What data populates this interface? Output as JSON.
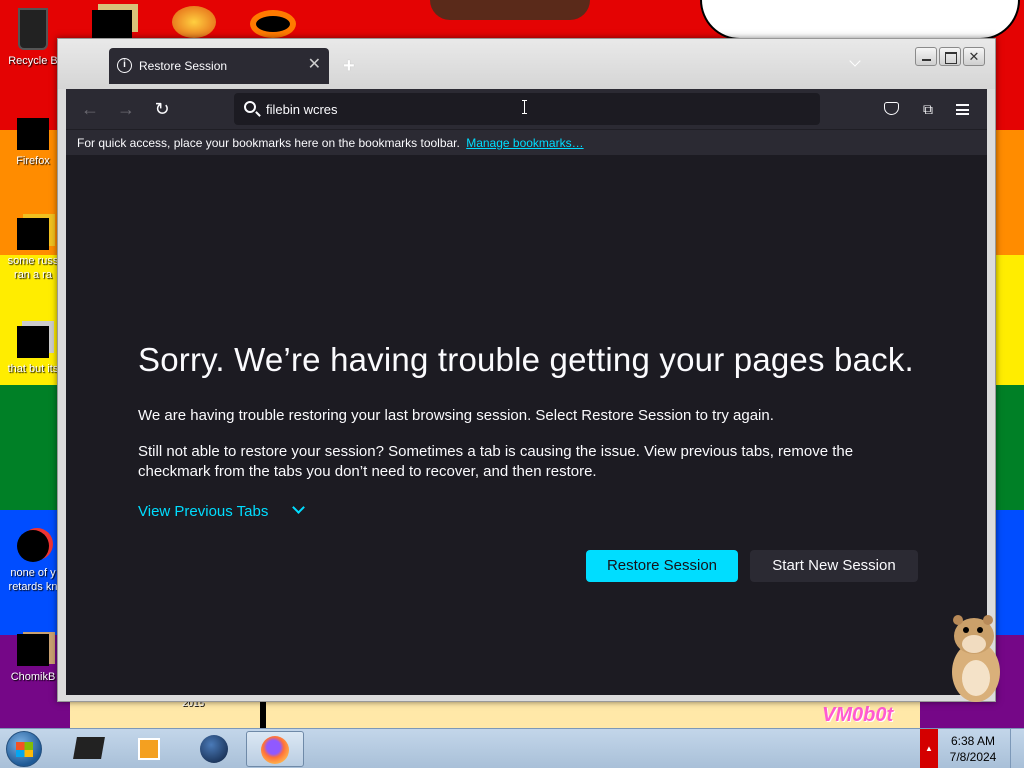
{
  "desktop": {
    "icons": [
      {
        "label": "Recycle B",
        "name": "recycle-bin"
      },
      {
        "label": "Firefox",
        "name": "firefox"
      },
      {
        "label": "some russ",
        "label2": "ran a ra",
        "name": "file-a"
      },
      {
        "label": "that but its",
        "name": "file-b"
      },
      {
        "label": "none of y",
        "label2": "retards kn",
        "name": "file-c"
      },
      {
        "label": "ChomikB",
        "name": "file-d"
      }
    ],
    "wallpaper_text": "VM0b0t",
    "year_text": "2015"
  },
  "browser": {
    "tab_title": "Restore Session",
    "tab_info_glyph": "i",
    "tab_close_glyph": "✕",
    "new_tab_glyph": "+",
    "url_value": "filebin wcres",
    "back_glyph": "←",
    "forward_glyph": "→",
    "reload_glyph": "↻",
    "extensions_glyph": "⧉",
    "bookmarks_bar_text": "For quick access, place your bookmarks here on the bookmarks toolbar.",
    "manage_bookmarks_label": "Manage bookmarks…"
  },
  "page": {
    "heading": "Sorry. We’re having trouble getting your pages back.",
    "paragraph1": "We are having trouble restoring your last browsing session. Select Restore Session to try again.",
    "paragraph2": "Still not able to restore your session? Sometimes a tab is causing the issue. View previous tabs, remove the checkmark from the tabs you don’t need to recover, and then restore.",
    "view_previous_tabs": "View Previous Tabs",
    "restore_session_label": "Restore Session",
    "start_new_session_label": "Start New Session"
  },
  "taskbar": {
    "time": "6:38 AM",
    "date": "7/8/2024",
    "tray_arrow_glyph": "▲"
  },
  "colors": {
    "accent": "#00ddff",
    "page_bg": "#1c1b22",
    "toolbar_bg": "#2b2a33"
  }
}
